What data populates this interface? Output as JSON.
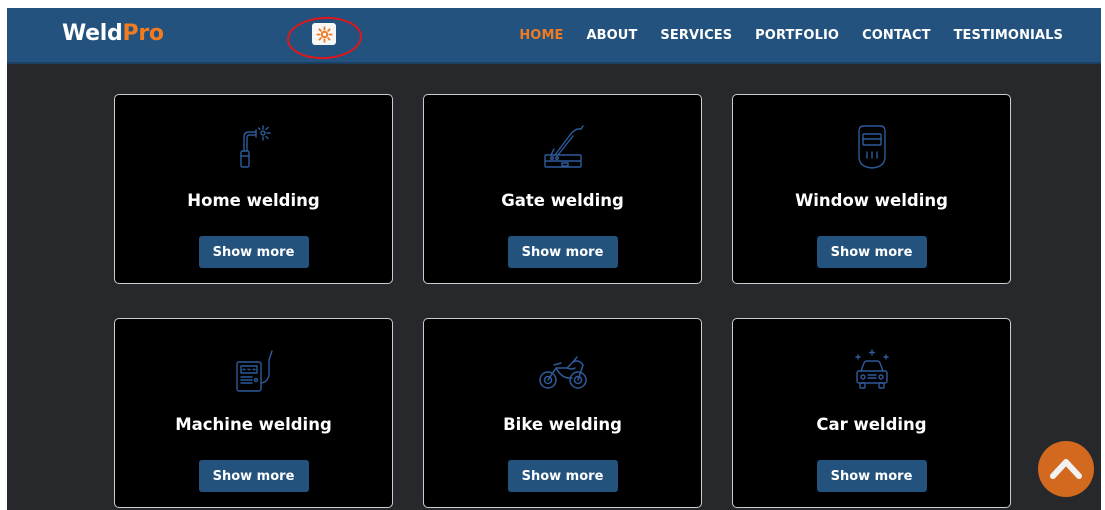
{
  "brand": {
    "part1": "Weld",
    "part2": "Pro"
  },
  "nav": [
    {
      "label": "HOME",
      "active": true
    },
    {
      "label": "ABOUT"
    },
    {
      "label": "SERVICES"
    },
    {
      "label": "PORTFOLIO"
    },
    {
      "label": "CONTACT"
    },
    {
      "label": "TESTIMONIALS"
    }
  ],
  "theme_toggle": {
    "icon": "sun-icon"
  },
  "cards": [
    {
      "title": "Home welding",
      "button": "Show more",
      "icon": "welding-torch-icon"
    },
    {
      "title": "Gate welding",
      "button": "Show more",
      "icon": "welding-machine-icon"
    },
    {
      "title": "Window welding",
      "button": "Show more",
      "icon": "welding-mask-icon"
    },
    {
      "title": "Machine welding",
      "button": "Show more",
      "icon": "welder-unit-icon"
    },
    {
      "title": "Bike welding",
      "button": "Show more",
      "icon": "motorcycle-icon"
    },
    {
      "title": "Car welding",
      "button": "Show more",
      "icon": "car-icon"
    }
  ],
  "colors": {
    "navbar": "#22527d",
    "accent": "#f07b22",
    "background": "#26282c",
    "card": "#000000",
    "button": "#23527d",
    "icon_stroke": "#2d5b9a",
    "scroll_top": "#d3691f",
    "highlight_ring": "#e0161c"
  }
}
